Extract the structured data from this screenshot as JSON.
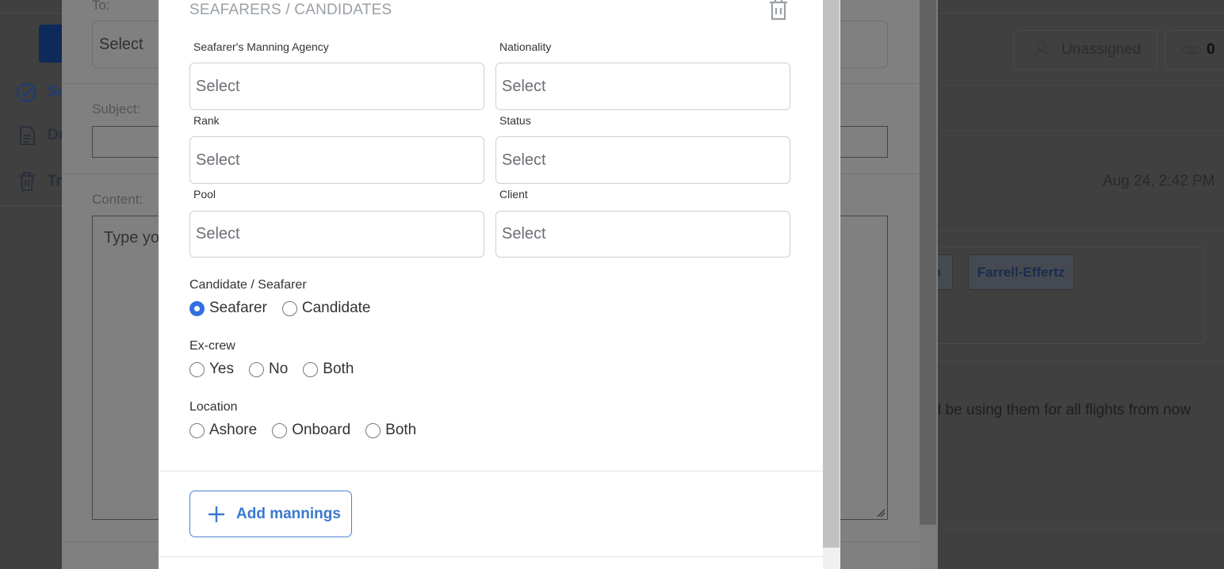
{
  "background": {
    "sidebar": {
      "items": [
        {
          "icon": "check-circle-icon",
          "label": "Se"
        },
        {
          "icon": "document-icon",
          "label": "Dr"
        },
        {
          "icon": "trash-icon",
          "label": "Tra"
        }
      ]
    },
    "header": {
      "assignee_label": "Unassigned",
      "views_count": "0"
    },
    "message": {
      "date": "Aug 24, 2:42 PM",
      "tags": [
        "n",
        "Farrell-Effertz"
      ],
      "body_fragment": "l be using them for all flights from now"
    },
    "compose": {
      "to_label": "To:",
      "to_placeholder": "Select",
      "subject_label": "Subject:",
      "subject_value": "",
      "content_label": "Content:",
      "content_placeholder": "Type you"
    }
  },
  "modal": {
    "section_title": "SEAFARERS / CANDIDATES",
    "delete_icon": "trash-icon",
    "fields": [
      {
        "label": "Seafarer's Manning Agency",
        "value": "Select"
      },
      {
        "label": "Nationality",
        "value": "Select"
      },
      {
        "label": "Rank",
        "value": "Select"
      },
      {
        "label": "Status",
        "value": "Select"
      },
      {
        "label": "Pool",
        "value": "Select"
      },
      {
        "label": "Client",
        "value": "Select"
      }
    ],
    "radio_groups": [
      {
        "label": "Candidate / Seafarer",
        "options": [
          {
            "label": "Seafarer",
            "checked": true
          },
          {
            "label": "Candidate",
            "checked": false
          }
        ]
      },
      {
        "label": "Ex-crew",
        "options": [
          {
            "label": "Yes",
            "checked": false
          },
          {
            "label": "No",
            "checked": false
          },
          {
            "label": "Both",
            "checked": false
          }
        ]
      },
      {
        "label": "Location",
        "options": [
          {
            "label": "Ashore",
            "checked": false
          },
          {
            "label": "Onboard",
            "checked": false
          },
          {
            "label": "Both",
            "checked": false
          }
        ]
      }
    ],
    "add_button": {
      "icon": "plus-icon",
      "label": "Add mannings"
    },
    "colors": {
      "accent": "#3a78cf",
      "radio_checked": "#2f6fe0",
      "title": "#9aa0a6"
    }
  }
}
